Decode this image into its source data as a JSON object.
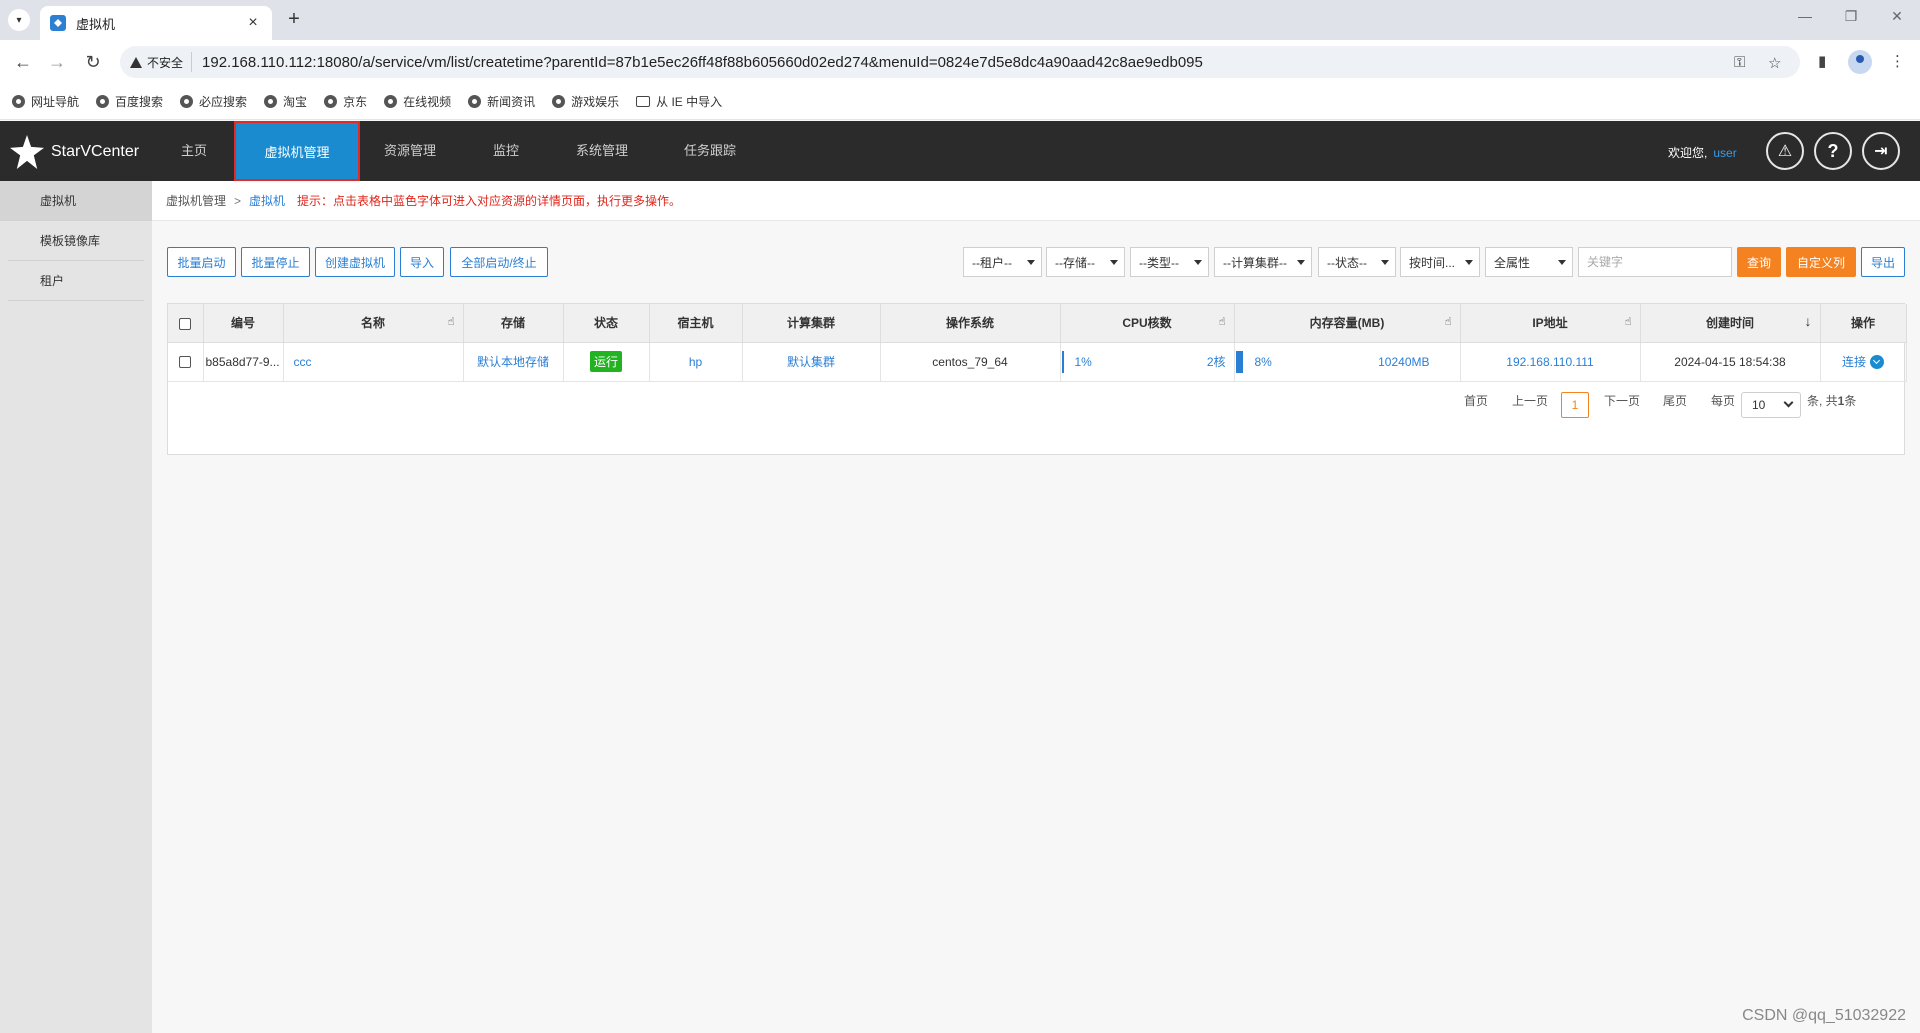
{
  "browser": {
    "tab_title": "虚拟机",
    "insecure_label": "不安全",
    "url": "192.168.110.112:18080/a/service/vm/list/createtime?parentId=87b1e5ec26ff48f88b605660d02ed274&menuId=0824e7d5e8dc4a90aad42c8ae9edb095",
    "bookmarks": [
      "网址导航",
      "百度搜索",
      "必应搜索",
      "淘宝",
      "京东",
      "在线视频",
      "新闻资讯",
      "游戏娱乐",
      "从 IE 中导入"
    ]
  },
  "header": {
    "logo_text": "StarVCenter",
    "nav": [
      "主页",
      "虚拟机管理",
      "资源管理",
      "监控",
      "系统管理",
      "任务跟踪"
    ],
    "active_nav": "虚拟机管理",
    "welcome": "欢迎您,",
    "user": "user"
  },
  "sidebar": {
    "items": [
      "虚拟机",
      "模板镜像库",
      "租户"
    ]
  },
  "breadcrumb": {
    "root": "虚拟机管理",
    "sep": ">",
    "current": "虚拟机",
    "tip": "提示：点击表格中蓝色字体可进入对应资源的详情页面，执行更多操作。"
  },
  "toolbar": {
    "buttons": [
      "批量启动",
      "批量停止",
      "创建虚拟机",
      "导入",
      "全部启动/终止"
    ],
    "filters": [
      "--租户--",
      "--存储--",
      "--类型--",
      "--计算集群--",
      "--状态--",
      "按时间...",
      "全属性"
    ],
    "keyword_placeholder": "关键字",
    "query": "查询",
    "custom_columns": "自定义列",
    "export": "导出"
  },
  "table": {
    "headers": [
      "编号",
      "名称",
      "存储",
      "状态",
      "宿主机",
      "计算集群",
      "操作系统",
      "CPU核数",
      "内存容量(MB)",
      "IP地址",
      "创建时间",
      "操作"
    ],
    "rows": [
      {
        "id": "b85a8d77-9...",
        "name": "ccc",
        "storage": "默认本地存储",
        "status": "运行",
        "host": "hp",
        "cluster": "默认集群",
        "os": "centos_79_64",
        "cpu_pct": "1%",
        "cpu_cores": "2核",
        "mem_pct": "8%",
        "mem": "10240MB",
        "ip": "192.168.110.111",
        "created": "2024-04-15 18:54:38",
        "action": "连接"
      }
    ]
  },
  "pager": {
    "first": "首页",
    "prev": "上一页",
    "current": "1",
    "next": "下一页",
    "last": "尾页",
    "per_page_label": "每页",
    "per_page": "10",
    "summary_prefix": "条, 共",
    "total": "1",
    "summary_suffix": "条"
  },
  "watermark": "CSDN @qq_51032922",
  "colors": {
    "accent": "#1b8bd0",
    "orange": "#f58220",
    "running": "#22b322",
    "tip_red": "#e0261b"
  }
}
